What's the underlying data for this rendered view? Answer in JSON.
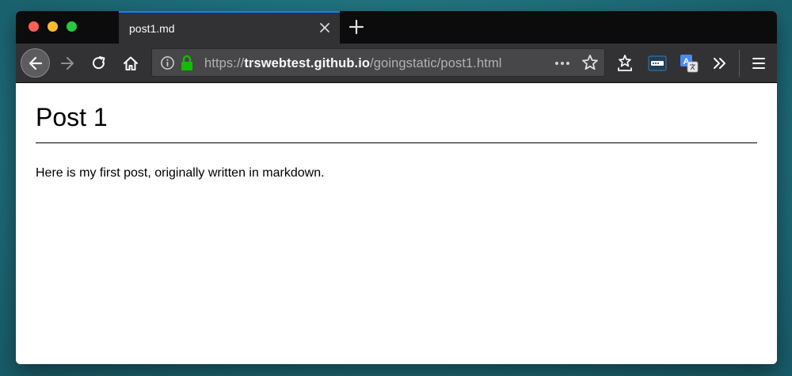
{
  "window": {
    "traffic_lights": [
      "#fe5f57",
      "#febc2e",
      "#28c840"
    ]
  },
  "tabbar": {
    "active_tab": {
      "title": "post1.md",
      "accent_color": "#0a84ff"
    },
    "icons": {
      "close": "close-icon",
      "new_tab": "plus-icon"
    }
  },
  "toolbar": {
    "nav_icons": [
      "back-arrow-icon",
      "forward-arrow-icon",
      "reload-icon",
      "home-icon"
    ],
    "url": {
      "scheme": "https://",
      "host": "trswebtest.github.io",
      "path": "/goingstatic/post1.html"
    },
    "url_icons": [
      "info-icon",
      "lock-icon",
      "page-actions-icon",
      "bookmark-star-icon"
    ],
    "right_icons": [
      "pocket-icon",
      "password-manager-icon",
      "translate-icon",
      "overflow-chevron-icon",
      "hamburger-menu-icon"
    ]
  },
  "page": {
    "title": "Post 1",
    "body": "Here is my first post, originally written in markdown."
  }
}
